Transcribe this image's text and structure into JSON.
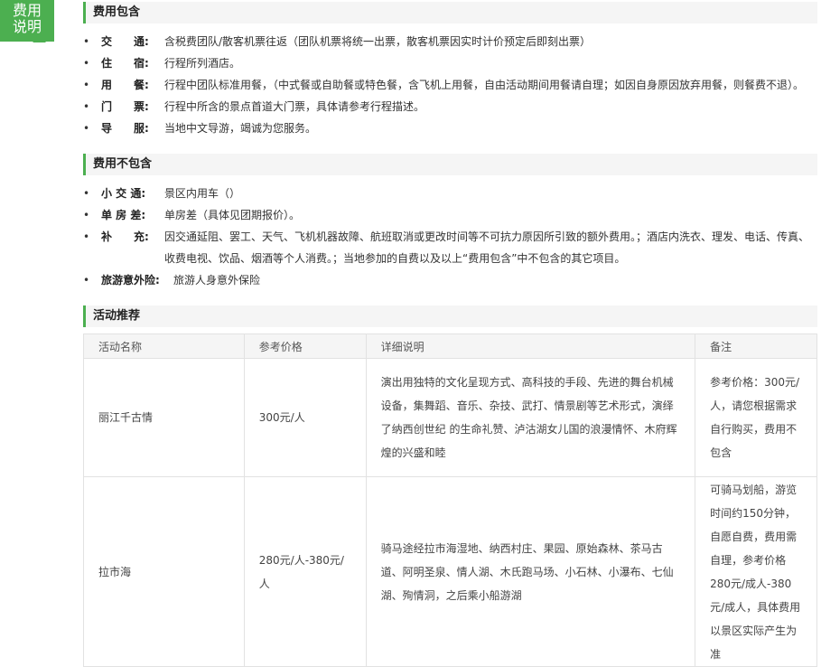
{
  "tag": {
    "line1": "费用",
    "line2": "说明"
  },
  "included": {
    "title": "费用包含",
    "items": [
      {
        "label": "交　　通:",
        "value": "含税费团队/散客机票往返（团队机票将统一出票，散客机票因实时计价预定后即刻出票）"
      },
      {
        "label": "住　　宿:",
        "value": "行程所列酒店。"
      },
      {
        "label": "用　　餐:",
        "value": "行程中团队标准用餐，（中式餐或自助餐或特色餐，含飞机上用餐，自由活动期间用餐请自理；如因自身原因放弃用餐，则餐费不退）。"
      },
      {
        "label": "门　　票:",
        "value": "行程中所含的景点首道大门票，具体请参考行程描述。"
      },
      {
        "label": "导　　服:",
        "value": "当地中文导游，竭诚为您服务。"
      }
    ]
  },
  "excluded": {
    "title": "费用不包含",
    "items": [
      {
        "label": "小 交 通:",
        "value": "景区内用车（）"
      },
      {
        "label": "单 房 差:",
        "value": "单房差（具体见团期报价）。"
      },
      {
        "label": "补　　充:",
        "value": "因交通延阻、罢工、天气、飞机机器故障、航班取消或更改时间等不可抗力原因所引致的额外费用。；酒店内洗衣、理发、电话、传真、收费电视、饮品、烟酒等个人消费。；当地参加的自费以及以上“费用包含”中不包含的其它项目。"
      },
      {
        "label": "旅游意外险:",
        "value": "旅游人身意外保险"
      }
    ]
  },
  "activities": {
    "title": "活动推荐",
    "headers": [
      "活动名称",
      "参考价格",
      "详细说明",
      "备注"
    ],
    "rows": [
      {
        "name": "丽江千古情",
        "price": "300元/人",
        "desc": "演出用独特的文化呈现方式、高科技的手段、先进的舞台机械设备，集舞蹈、音乐、杂技、武打、情景剧等艺术形式，演绎了纳西创世纪 的生命礼赞、泸沽湖女儿国的浪漫情怀、木府辉煌的兴盛和睦",
        "note": "参考价格：300元/人，请您根据需求自行购买，费用不包含"
      },
      {
        "name": "拉市海",
        "price": "280元/人-380元/人",
        "desc": "骑马途经拉市海湿地、纳西村庄、果园、原始森林、茶马古道、阿明圣泉、情人湖、木氏跑马场、小石林、小瀑布、七仙湖、殉情洞，之后乘小船游湖",
        "note": "可骑马划船，游览时间约150分钟，自愿自费，费用需自理，参考价格280元/成人-380元/成人，具体费用以景区实际产生为准"
      }
    ]
  }
}
